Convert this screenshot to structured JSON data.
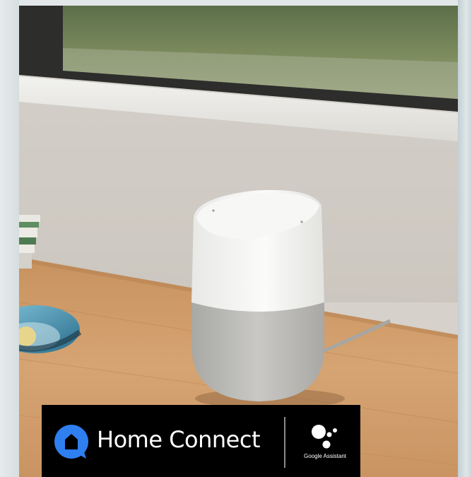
{
  "banner": {
    "brand": "Home Connect",
    "partner": "Google Assistant"
  },
  "colors": {
    "background": "#dfe5e7",
    "brand_blue": "#2f7ff0",
    "banner_bg": "#000000",
    "speaker_top": "#f2f2f0",
    "speaker_fabric": "#bdbcb8",
    "table_wood": "#cf9a68"
  },
  "icons": {
    "brand": "home-connect-logo-icon",
    "partner": "google-assistant-icon"
  }
}
